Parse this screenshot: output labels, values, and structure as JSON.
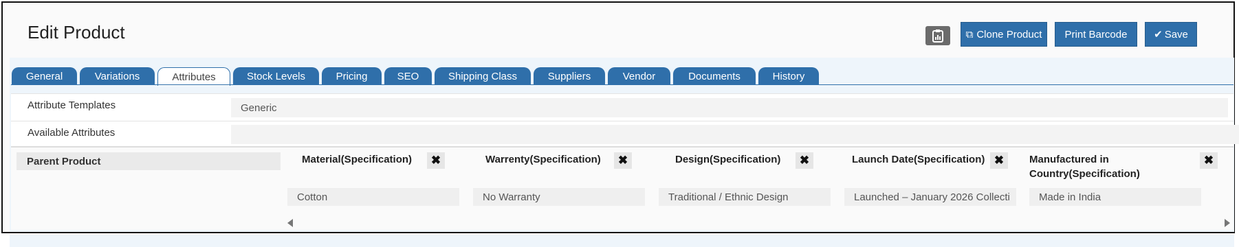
{
  "page": {
    "title": "Edit Product"
  },
  "toolbar": {
    "report_icon": "clipboard-chart-icon",
    "clone_label": "Clone Product",
    "print_barcode_label": "Print Barcode",
    "save_label": "Save",
    "save_icon": "✔",
    "clone_icon": "⧉"
  },
  "tabs": [
    {
      "label": "General"
    },
    {
      "label": "Variations"
    },
    {
      "label": "Attributes",
      "active": true
    },
    {
      "label": "Stock Levels"
    },
    {
      "label": "Pricing"
    },
    {
      "label": "SEO"
    },
    {
      "label": "Shipping Class"
    },
    {
      "label": "Suppliers"
    },
    {
      "label": "Vendor"
    },
    {
      "label": "Documents"
    },
    {
      "label": "History"
    }
  ],
  "form": {
    "attribute_templates": {
      "label": "Attribute Templates",
      "value": "Generic"
    },
    "available_attributes": {
      "label": "Available Attributes",
      "value": ""
    }
  },
  "attributes_table": {
    "parent_label": "Parent Product",
    "remove_symbol": "✖",
    "columns": [
      {
        "header": "Material(Specification)",
        "value": "Cotton"
      },
      {
        "header": "Warrenty(Specification)",
        "value": "No Warranty"
      },
      {
        "header": "Design(Specification)",
        "value": "Traditional / Ethnic Design"
      },
      {
        "header": "Launch Date(Specification)",
        "value": "Launched – January 2026 Collecti"
      },
      {
        "header": "Manufactured in Country(Specification)",
        "value": "Made in India"
      }
    ]
  },
  "colors": {
    "primary": "#2f6faa",
    "panel": "#eef5fb"
  }
}
